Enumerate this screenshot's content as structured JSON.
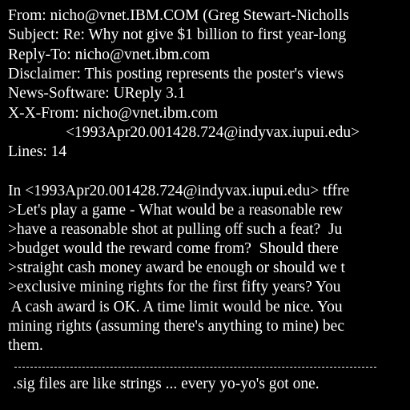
{
  "colors": {
    "background": "#000000",
    "text": "#ffffff"
  },
  "header": {
    "from": "From: nicho@vnet.IBM.COM (Greg Stewart-Nicholls",
    "subject": "Subject: Re: Why not give $1 billion to first year-long",
    "reply_to": "Reply-To: nicho@vnet.ibm.com",
    "disclaimer": "Disclaimer: This posting represents the poster's views",
    "news_software": "News-Software: UReply 3.1",
    "x_x_from": "X-X-From: nicho@vnet.ibm.com",
    "message_ref": "<1993Apr20.001428.724@indyvax.iupui.edu>",
    "lines": "Lines: 14"
  },
  "body": {
    "intro": "In <1993Apr20.001428.724@indyvax.iupui.edu> tffre",
    "quoted": [
      ">Let's play a game - What would be a reasonable rew",
      ">have a reasonable shot at pulling off such a feat?  Ju",
      ">budget would the reward come from?  Should there",
      ">straight cash money award be enough or should we t",
      ">exclusive mining rights for the first fifty years? You"
    ],
    "reply": [
      " A cash award is OK. A time limit would be nice. You",
      "mining rights (assuming there's anything to mine) bec",
      "them."
    ]
  },
  "signature": {
    "text": ".sig files are like strings ... every yo-yo's got one."
  }
}
